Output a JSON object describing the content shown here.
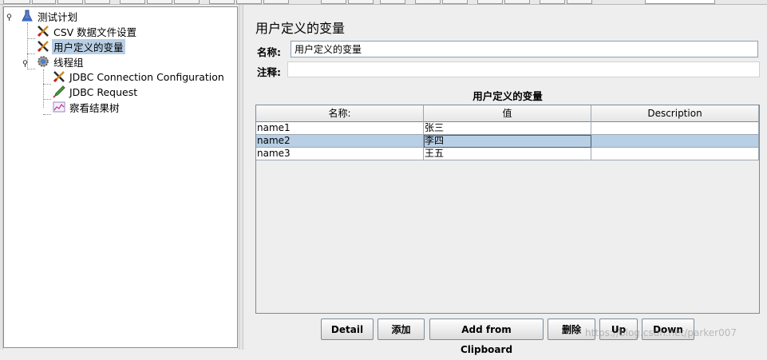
{
  "tree": {
    "root": "测试计划",
    "csv": "CSV 数据文件设置",
    "vars": "用户定义的变量",
    "thread_group": "线程组",
    "jdbc_config": "JDBC Connection Configuration",
    "jdbc_request": "JDBC Request",
    "results_tree": "察看结果树"
  },
  "panel": {
    "title": "用户定义的变量",
    "name_label": "名称:",
    "name_value": "用户定义的变量",
    "comment_label": "注释:",
    "comment_value": "",
    "table_title": "用户定义的变量"
  },
  "table": {
    "headers": [
      "名称:",
      "值",
      "Description"
    ],
    "rows": [
      {
        "name": "name1",
        "value": "张三",
        "desc": ""
      },
      {
        "name": "name2",
        "value": "李四",
        "desc": ""
      },
      {
        "name": "name3",
        "value": "王五",
        "desc": ""
      }
    ],
    "selected_row": 1
  },
  "buttons": {
    "detail": "Detail",
    "add": "添加",
    "add_clipboard": "Add from Clipboard",
    "delete": "删除",
    "up": "Up",
    "down": "Down"
  },
  "watermark": "https://blog.csdn.net/parker007",
  "colors": {
    "selection": "#b8cfe5",
    "background": "#eeeeee",
    "border": "#7a8a99"
  },
  "icons": [
    "test-plan-icon",
    "wrench-config-icon",
    "gear-thread-group-icon",
    "pipette-sampler-icon",
    "graph-listener-icon"
  ]
}
